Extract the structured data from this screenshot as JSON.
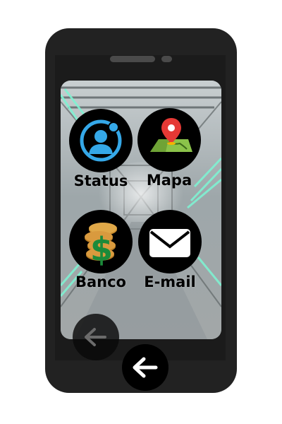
{
  "apps": [
    {
      "id": "status",
      "label": "Status",
      "icon": "user-icon"
    },
    {
      "id": "mapa",
      "label": "Mapa",
      "icon": "map-pin-icon"
    },
    {
      "id": "banco",
      "label": "Banco",
      "icon": "money-bag-icon"
    },
    {
      "id": "email",
      "label": "E-mail",
      "icon": "envelope-icon"
    }
  ],
  "navigation": {
    "screen_back_icon": "arrow-left-icon",
    "home_back_icon": "arrow-left-icon"
  },
  "colors": {
    "phone_body": "#222222",
    "app_circle": "#000000",
    "status_accent": "#35a8e8",
    "map_pin": "#e53935",
    "map_land": "#8bc34a",
    "money_green": "#1b8a3a",
    "coin_gold": "#c98a2b"
  }
}
